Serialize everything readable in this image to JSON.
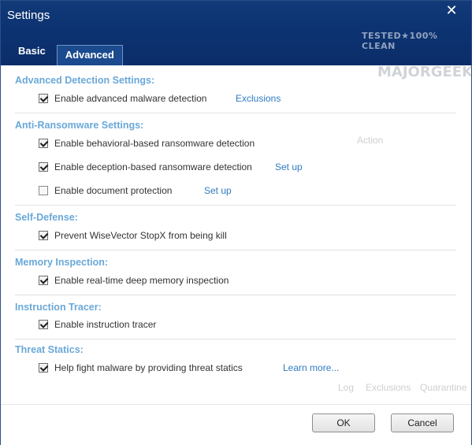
{
  "window": {
    "title": "Settings"
  },
  "tabs": [
    {
      "label": "Basic"
    },
    {
      "label": "Advanced"
    }
  ],
  "watermark": {
    "line1": "TESTED★100% CLEAN",
    "line2": "MAJORGEEKS"
  },
  "sections": {
    "advanced_detection": {
      "title": "Advanced Detection Settings:",
      "items": [
        {
          "label": "Enable advanced malware detection",
          "checked": true,
          "link": "Exclusions"
        }
      ]
    },
    "anti_ransomware": {
      "title": "Anti-Ransomware Settings:",
      "items": [
        {
          "label": "Enable behavioral-based ransomware detection",
          "checked": true
        },
        {
          "label": "Enable deception-based ransomware detection",
          "checked": true,
          "link": "Set up"
        },
        {
          "label": "Enable document protection",
          "checked": false,
          "link": "Set up"
        }
      ]
    },
    "self_defense": {
      "title": "Self-Defense:",
      "items": [
        {
          "label": "Prevent WiseVector StopX from being kill",
          "checked": true
        }
      ]
    },
    "memory_inspection": {
      "title": "Memory Inspection:",
      "items": [
        {
          "label": "Enable real-time deep memory inspection",
          "checked": true
        }
      ]
    },
    "instruction_tracer": {
      "title": "Instruction Tracer:",
      "items": [
        {
          "label": "Enable instruction tracer",
          "checked": true
        }
      ]
    },
    "threat_statics": {
      "title": "Threat Statics:",
      "items": [
        {
          "label": "Help fight malware by providing threat statics",
          "checked": true,
          "link": "Learn more..."
        }
      ]
    }
  },
  "background_ghost": {
    "action": "Action",
    "log": "Log",
    "exclusions": "Exclusions",
    "quarantine": "Quarantine"
  },
  "footer": {
    "ok_label": "OK",
    "cancel_label": "Cancel"
  }
}
